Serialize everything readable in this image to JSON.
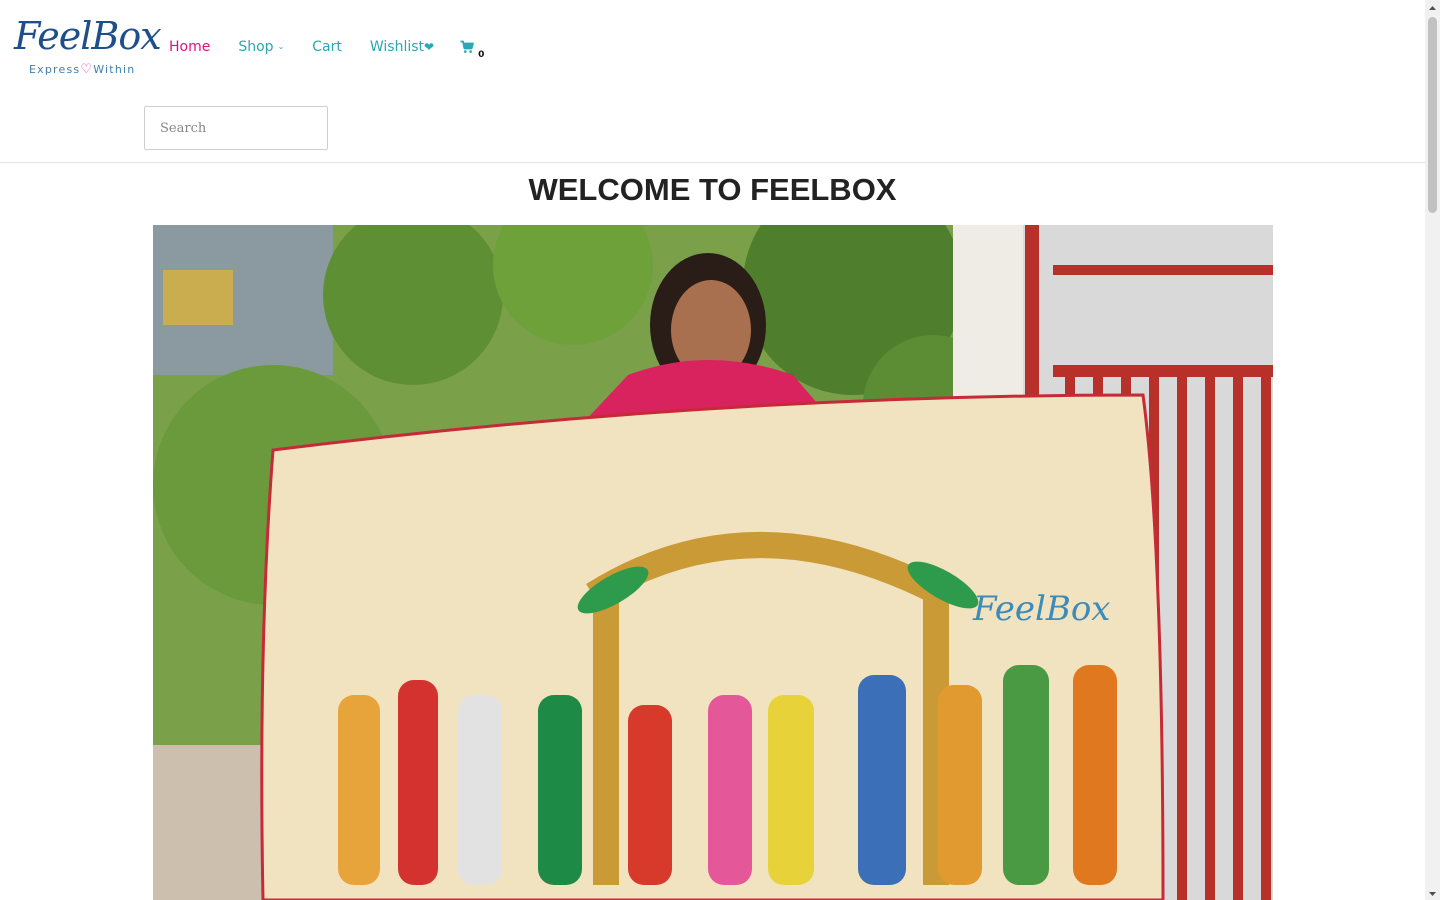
{
  "brand": {
    "name_part1": "FeelBo",
    "name_part2": "x",
    "tagline_part1": "Express",
    "tagline_heart": "♡",
    "tagline_part2": "Within"
  },
  "nav": {
    "items": [
      {
        "label": "Home",
        "active": true
      },
      {
        "label": "Shop",
        "has_dropdown": true,
        "caret": "⌄"
      },
      {
        "label": "Cart"
      },
      {
        "label": "Wishlist",
        "heart": "❤"
      }
    ],
    "cart_count": "0",
    "cart_icon": "shopping-cart-icon"
  },
  "search": {
    "placeholder": "Search",
    "value": ""
  },
  "main": {
    "title": "WELCOME TO FEELBOX",
    "hero_image": {
      "watermark": "FeelBox"
    }
  },
  "colors": {
    "nav_link": "#2aa7b5",
    "nav_active": "#e0127f",
    "title": "#222222",
    "brand_blue": "#1f4f8a"
  }
}
